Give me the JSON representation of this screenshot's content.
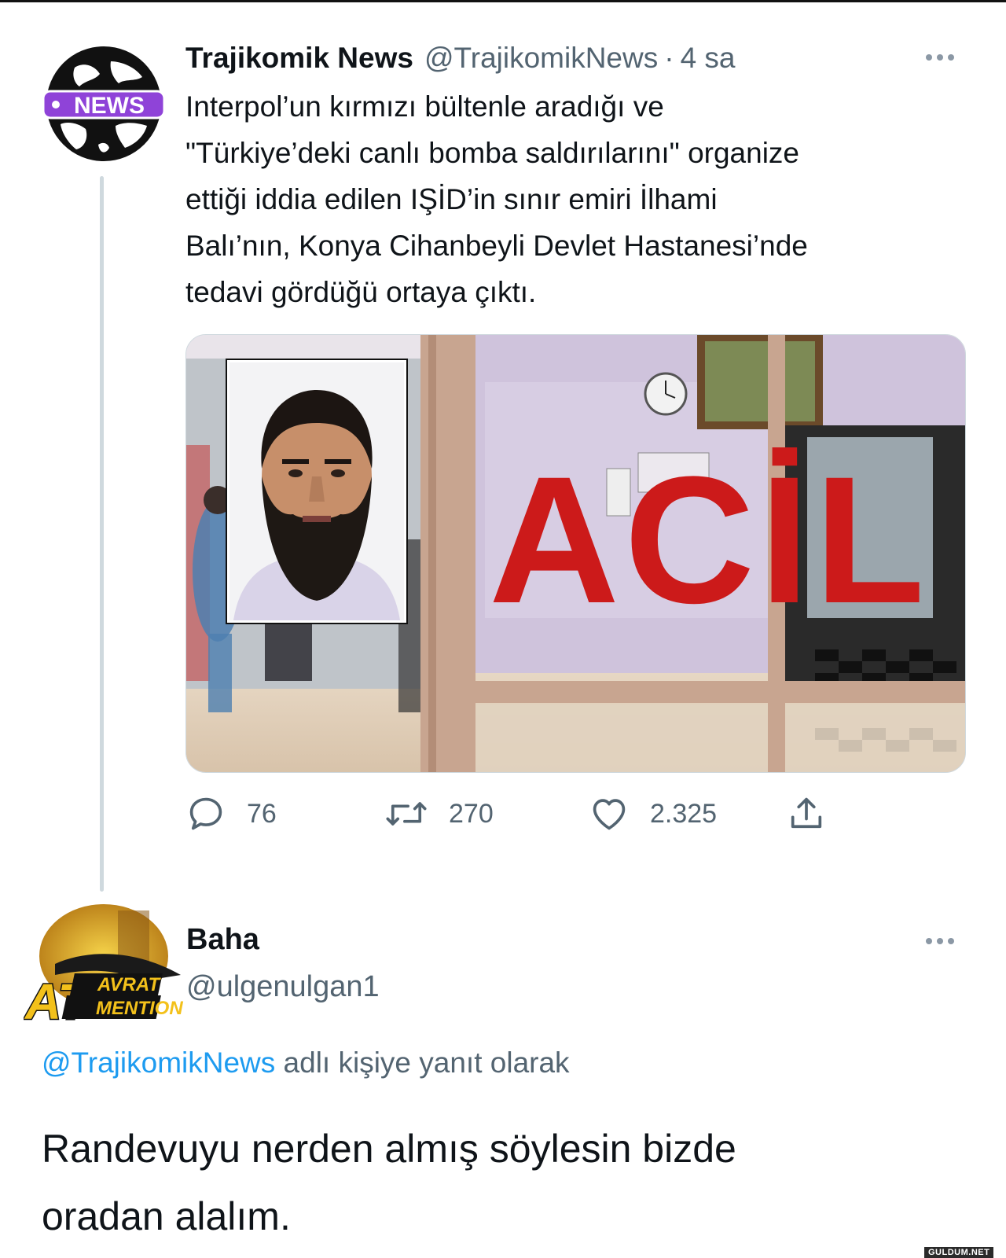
{
  "tweet": {
    "author_name": "Trajikomik News",
    "author_handle": "@TrajikomikNews",
    "separator": "·",
    "time": "4 sa",
    "avatar_badge": "NEWS",
    "text_lines": [
      "Interpol’un kırmızı bültenle aradığı ve",
      "\"Türkiye’deki canlı bomba saldırılarını\" organize",
      "ettiği iddia edilen IŞİD’in sınır emiri İlhami",
      "Balı’nın, Konya Cihanbeyli Devlet Hastanesi’nde",
      "tedavi gördüğü ortaya çıktı."
    ],
    "media": {
      "sign_text": "ACİL"
    },
    "actions": {
      "replies": "76",
      "retweets": "270",
      "likes": "2.325"
    }
  },
  "reply": {
    "author_name": "Baha",
    "author_handle": "@ulgenulgan1",
    "avatar_text_big": "AT",
    "avatar_text_top": "AVRAT",
    "avatar_text_bottom": "MENTION",
    "context_mention": "@TrajikomikNews",
    "context_text": "adlı kişiye yanıt olarak",
    "text_lines": [
      "Randevuyu nerden almış söylesin bizde",
      "oradan alalım."
    ]
  },
  "watermark": "GULDUM.NET",
  "colors": {
    "text_primary": "#0f1419",
    "text_secondary": "#536471",
    "link": "#1d9bf0",
    "news_badge": "#8f43d8",
    "acil_red": "#cc1a1a"
  }
}
